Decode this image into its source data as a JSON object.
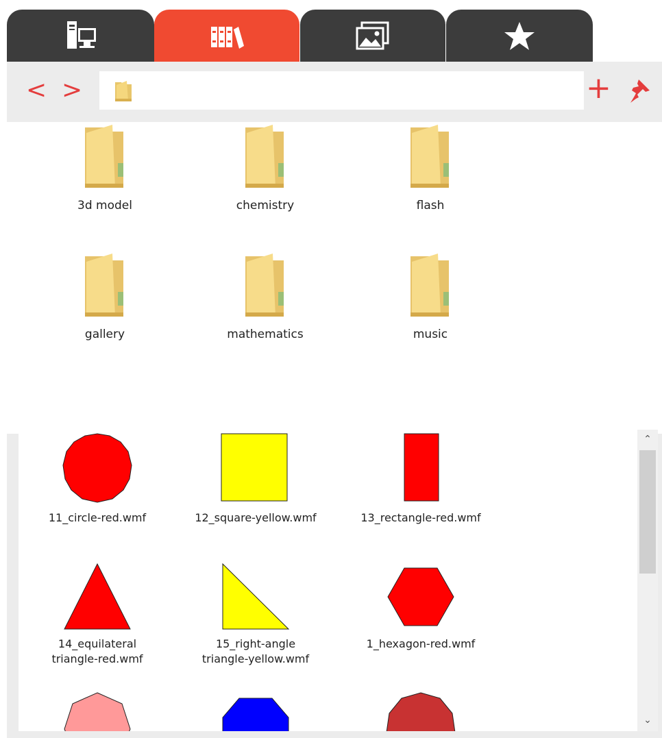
{
  "tabs": [
    {
      "icon": "computer-icon",
      "active": false
    },
    {
      "icon": "library-books-icon",
      "active": true
    },
    {
      "icon": "image-gallery-icon",
      "active": false
    },
    {
      "icon": "star-icon",
      "active": false
    }
  ],
  "nav": {
    "back": "<",
    "forward": ">",
    "path_value": "",
    "add": "+"
  },
  "folders": [
    {
      "label": "3d model"
    },
    {
      "label": "chemistry"
    },
    {
      "label": "flash"
    },
    {
      "label": "gallery"
    },
    {
      "label": "mathematics"
    },
    {
      "label": "music"
    }
  ],
  "search": {
    "value": ""
  },
  "items": [
    {
      "caption": "11_circle-red.wmf",
      "shape": "circle",
      "color": "#ff0000"
    },
    {
      "caption": "12_square-yellow.wmf",
      "shape": "square",
      "color": "#ffff00"
    },
    {
      "caption": "13_rectangle-red.wmf",
      "shape": "rectangle",
      "color": "#ff0000"
    },
    {
      "caption1": "14_equilateral",
      "caption2": "triangle-red.wmf",
      "shape": "triangle",
      "color": "#ff0000"
    },
    {
      "caption1": "15_right-angle",
      "caption2": "triangle-yellow.wmf",
      "shape": "right-triangle",
      "color": "#ffff00"
    },
    {
      "caption": "1_hexagon-red.wmf",
      "shape": "hexagon",
      "color": "#ff0000"
    },
    {
      "shape": "heptagon",
      "color": "#ff9999"
    },
    {
      "shape": "octagon",
      "color": "#0000ff"
    },
    {
      "shape": "nonagon",
      "color": "#c83232"
    }
  ],
  "colors": {
    "accent": "#f04a31",
    "tab_dark": "#3c3c3c",
    "icon_red": "#e43d3d"
  }
}
